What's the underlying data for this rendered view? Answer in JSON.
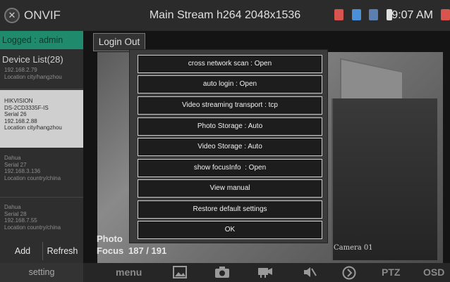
{
  "topbar": {
    "brand": "ONVIF",
    "title": "Main Stream h264 2048x1536",
    "time": "9:07 AM"
  },
  "sidebar": {
    "logged": "Logged : admin",
    "device_list_title": "Device List(28)",
    "devices": [
      {
        "lines": [
          "192.168.2.79",
          "Location city/hangzhou"
        ]
      },
      {
        "lines": [
          "HIKVISION",
          "DS-2CD3335F-IS",
          "Serial 26",
          "192.168.2.88",
          "Location city/hangzhou"
        ]
      },
      {
        "lines": [
          "Dahua",
          "Serial 27",
          "192.168.3.136",
          "Location country/china"
        ]
      },
      {
        "lines": [
          "Dahua",
          "Serial 28",
          "192.168.7.55",
          "Location country/china"
        ]
      }
    ],
    "add_label": "Add",
    "refresh_label": "Refresh"
  },
  "main": {
    "login_out_label": "Login Out",
    "photo_label": "Photo",
    "focus_label": "Focus",
    "focus_value": "187 / 191",
    "camera_label": "Camera 01"
  },
  "dialog": {
    "options": [
      "cross network scan : Open",
      "auto login    : Open",
      "Video streaming transport : tcp",
      "Photo Storage : Auto",
      "Video Storage : Auto",
      "show focusInfo  : Open",
      "View manual",
      "Restore default settings",
      "OK"
    ]
  },
  "bottombar": {
    "setting_label": "setting",
    "menu_label": "menu",
    "ptz_label": "PTZ",
    "osd_label": "OSD"
  },
  "colors": {
    "logged_bg": "#1f8a6c",
    "dialog_bg": "#3b3b3b",
    "option_bg": "#1d1d1d",
    "selected_device_bg": "#cfcfcf"
  }
}
